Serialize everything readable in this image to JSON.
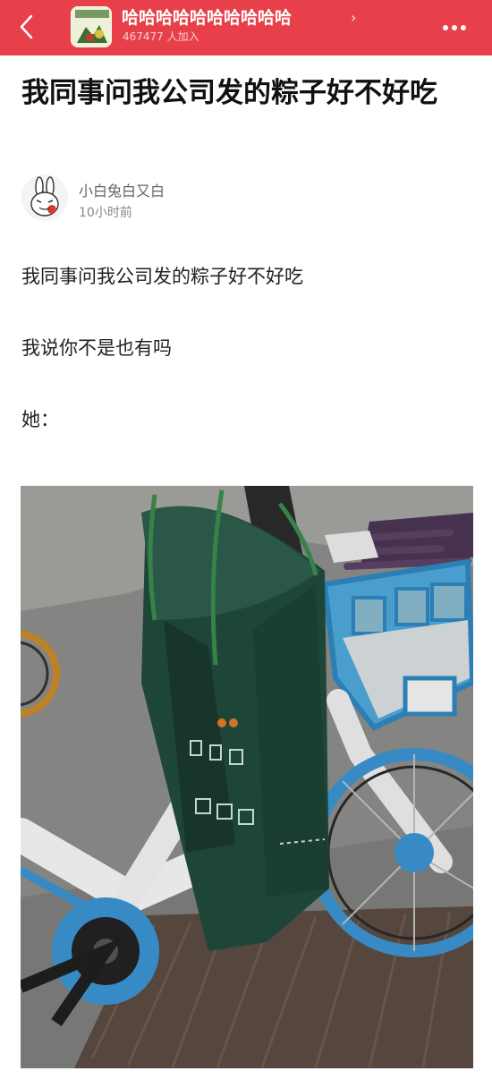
{
  "header": {
    "back_icon": "chevron-left-icon",
    "group_name": "哈哈哈哈哈哈哈哈哈哈",
    "group_chevron": "›",
    "member_count": "467477 人加入",
    "more_icon": "more-dots-icon",
    "bar_color": "#e8404a"
  },
  "post": {
    "title": "我同事问我公司发的粽子好不好吃",
    "author": "小白兔白又白",
    "time": "10小时前",
    "lines": [
      "我同事问我公司发的粽子好不好吃",
      "我说你不是也有吗",
      "她："
    ]
  }
}
